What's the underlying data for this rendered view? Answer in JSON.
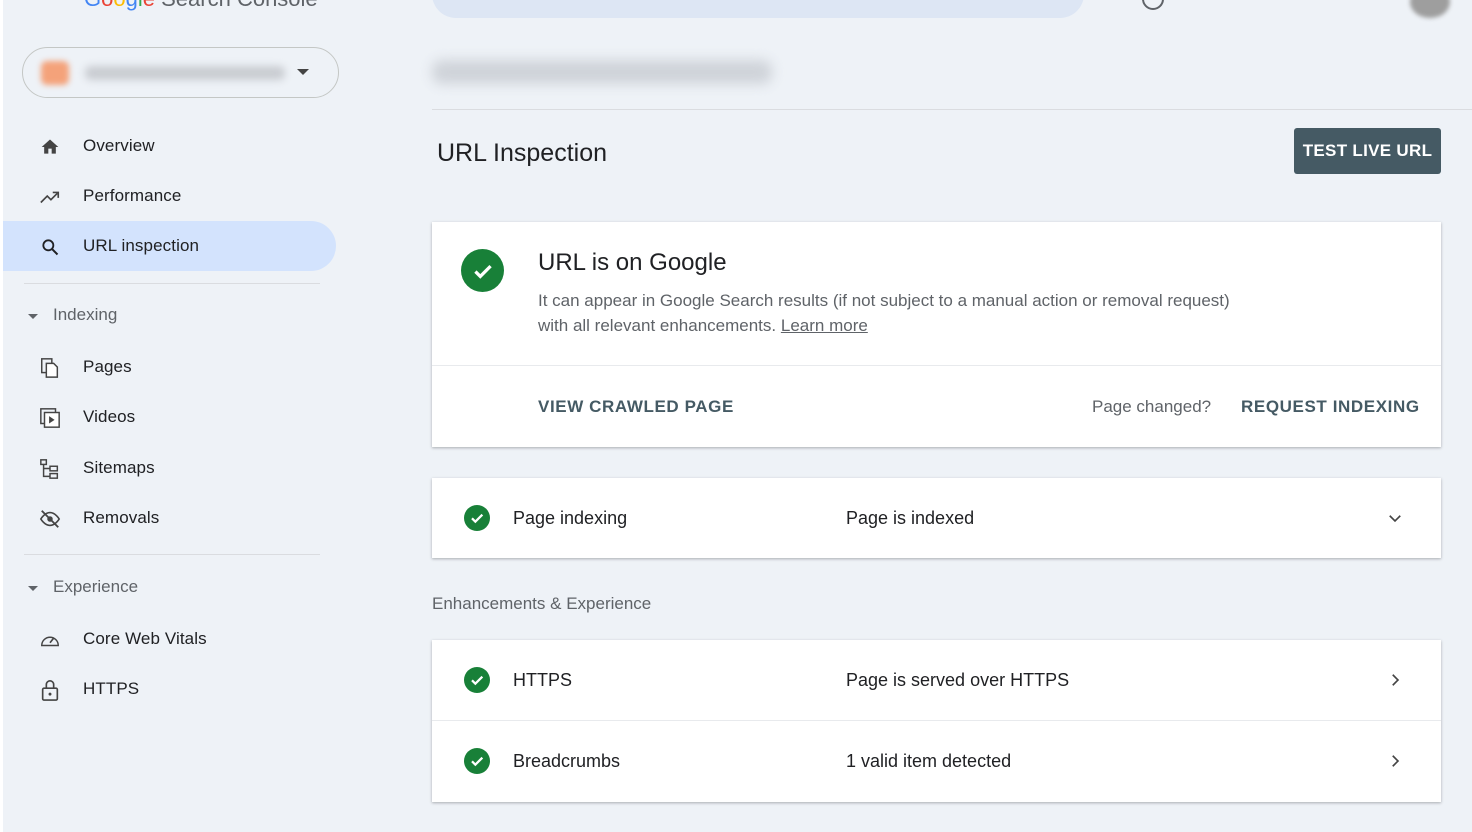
{
  "app": {
    "title_parts": [
      "G",
      "o",
      "o",
      "g",
      "l",
      "e",
      " Search Console"
    ]
  },
  "sidebar": {
    "items_top": [
      {
        "label": "Overview",
        "icon": "home-icon"
      },
      {
        "label": "Performance",
        "icon": "trending-up-icon"
      },
      {
        "label": "URL inspection",
        "icon": "search-icon",
        "active": true
      }
    ],
    "sections": [
      {
        "label": "Indexing",
        "items": [
          {
            "label": "Pages",
            "icon": "pages-icon"
          },
          {
            "label": "Videos",
            "icon": "videos-icon"
          },
          {
            "label": "Sitemaps",
            "icon": "sitemaps-icon"
          },
          {
            "label": "Removals",
            "icon": "removals-icon"
          }
        ]
      },
      {
        "label": "Experience",
        "items": [
          {
            "label": "Core Web Vitals",
            "icon": "speed-gauge-icon"
          },
          {
            "label": "HTTPS",
            "icon": "lock-icon"
          }
        ]
      }
    ]
  },
  "main": {
    "title": "URL Inspection",
    "test_live_button": "TEST LIVE URL",
    "status": {
      "title": "URL is on Google",
      "description": "It can appear in Google Search results (if not subject to a manual action or removal request) with all relevant enhancements.",
      "learn_more": "Learn more",
      "view_crawled": "VIEW CRAWLED PAGE",
      "page_changed": "Page changed?",
      "request_indexing": "REQUEST INDEXING"
    },
    "indexing": {
      "label": "Page indexing",
      "value": "Page is indexed"
    },
    "enhancements_header": "Enhancements & Experience",
    "enhancements": [
      {
        "label": "HTTPS",
        "value": "Page is served over HTTPS"
      },
      {
        "label": "Breadcrumbs",
        "value": "1 valid item detected"
      }
    ]
  },
  "colors": {
    "accent_active": "#d3e3fd",
    "success": "#188038",
    "button_dark": "#455a64",
    "background": "#eef2f7"
  }
}
